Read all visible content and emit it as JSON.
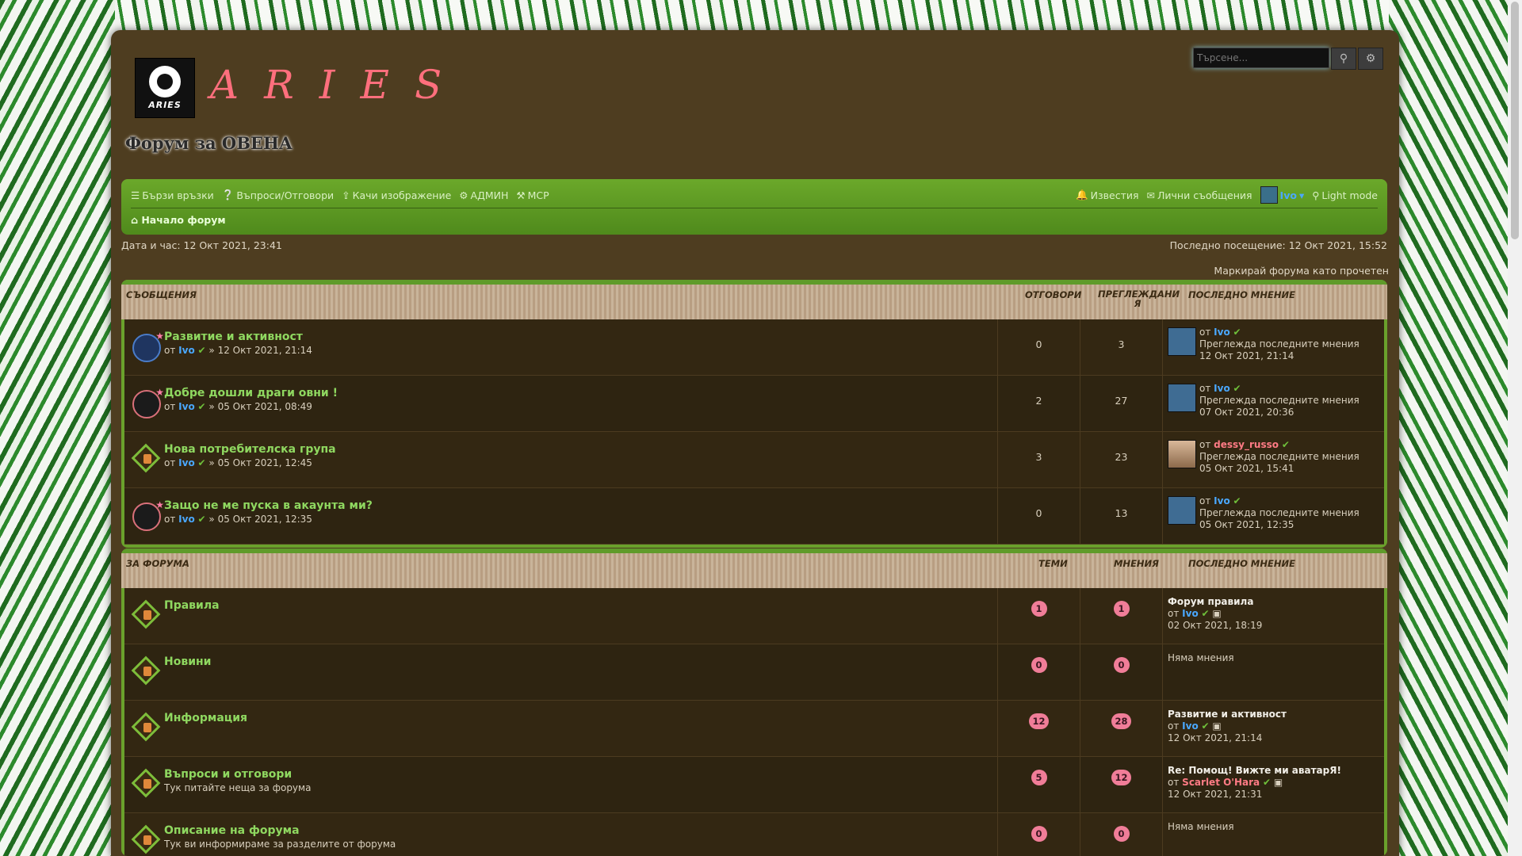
{
  "header": {
    "logo_text": "ARIES",
    "site_name": "ARIES",
    "site_desc": "Форум за ОВЕНА",
    "search_placeholder": "Търсене..."
  },
  "nav": {
    "quick_links": "Бързи връзки",
    "faq": "Въпроси/Отговори",
    "upload": "Качи изображение",
    "admin": "АДМИН",
    "mcp": "МСР",
    "notifications": "Известия",
    "pm": "Лични съобщения",
    "user": "Ivo",
    "light_mode": "Light mode",
    "breadcrumb": "Начало форум"
  },
  "datebar": {
    "now": "Дата и час: 12 Окт 2021, 23:41",
    "last_visit": "Последно посещение: 12 Окт 2021, 15:52",
    "mark_read": "Маркирай форума като прочетен"
  },
  "topics": {
    "head": {
      "title": "СЪОБЩЕНИЯ",
      "replies": "ОТГОВОРИ",
      "views": "ПРЕГЛЕЖДАНИ\nЯ",
      "last": "ПОСЛЕДНО МНЕНИЕ"
    },
    "rows": [
      {
        "title": "Развитие и активност",
        "by": "от",
        "author": "Ivo",
        "date": "» 12 Окт 2021, 21:14",
        "replies": "0",
        "views": "3",
        "lp_by": "от",
        "lp_user": "Ivo",
        "lp_status": "Преглежда последните мнения",
        "lp_date": "12 Окт 2021, 21:14"
      },
      {
        "title": "Добре дошли драги овни !",
        "by": "от",
        "author": "Ivo",
        "date": "» 05 Окт 2021, 08:49",
        "replies": "2",
        "views": "27",
        "lp_by": "от",
        "lp_user": "Ivo",
        "lp_status": "Преглежда последните мнения",
        "lp_date": "07 Окт 2021, 20:36"
      },
      {
        "title": "Нова потребителска група",
        "by": "от",
        "author": "Ivo",
        "date": "» 05 Окт 2021, 12:45",
        "replies": "3",
        "views": "23",
        "lp_by": "от",
        "lp_user": "dessy_russo",
        "lp_status": "Преглежда последните мнения",
        "lp_date": "05 Окт 2021, 15:41"
      },
      {
        "title": "Защо не ме пуска в акаунта ми?",
        "by": "от",
        "author": "Ivo",
        "date": "» 05 Окт 2021, 12:35",
        "replies": "0",
        "views": "13",
        "lp_by": "от",
        "lp_user": "Ivo",
        "lp_status": "Преглежда последните мнения",
        "lp_date": "05 Окт 2021, 12:35"
      }
    ]
  },
  "forums": {
    "head": {
      "title": "ЗА ФОРУМА",
      "topics": "ТЕМИ",
      "posts": "МНЕНИЯ",
      "last": "ПОСЛЕДНО МНЕНИЕ"
    },
    "rows": [
      {
        "title": "Правила",
        "desc": "",
        "topics": "1",
        "posts": "1",
        "lp_title": "Форум правила",
        "lp_by": "от",
        "lp_user": "Ivo",
        "lp_date": "02 Окт 2021, 18:19",
        "no_posts": ""
      },
      {
        "title": "Новини",
        "desc": "",
        "topics": "0",
        "posts": "0",
        "lp_title": "",
        "lp_by": "",
        "lp_user": "",
        "lp_date": "",
        "no_posts": "Няма мнения"
      },
      {
        "title": "Информация",
        "desc": "",
        "topics": "12",
        "posts": "28",
        "lp_title": "Развитие и активност",
        "lp_by": "от",
        "lp_user": "Ivo",
        "lp_date": "12 Окт 2021, 21:14",
        "no_posts": ""
      },
      {
        "title": "Въпроси и отговори",
        "desc": "Тук питайте неща за форума",
        "topics": "5",
        "posts": "12",
        "lp_title": "Re: Помощ! Вижте ми аватарЯ!",
        "lp_by": "от",
        "lp_user": "Scarlet O'Hara",
        "lp_date": "12 Окт 2021, 21:31",
        "no_posts": ""
      },
      {
        "title": "Описание на форума",
        "desc": "Тук ви информираме за разделите от форума",
        "topics": "0",
        "posts": "0",
        "lp_title": "",
        "lp_by": "",
        "lp_user": "",
        "lp_date": "",
        "no_posts": "Няма мнения"
      }
    ]
  },
  "colors": {
    "accent": "#6aa12c",
    "panel": "#4e3d20",
    "title": "#8fd860",
    "user": "#4aa8ff",
    "badge": "#f07d98",
    "brand": "#ff6f7d"
  }
}
